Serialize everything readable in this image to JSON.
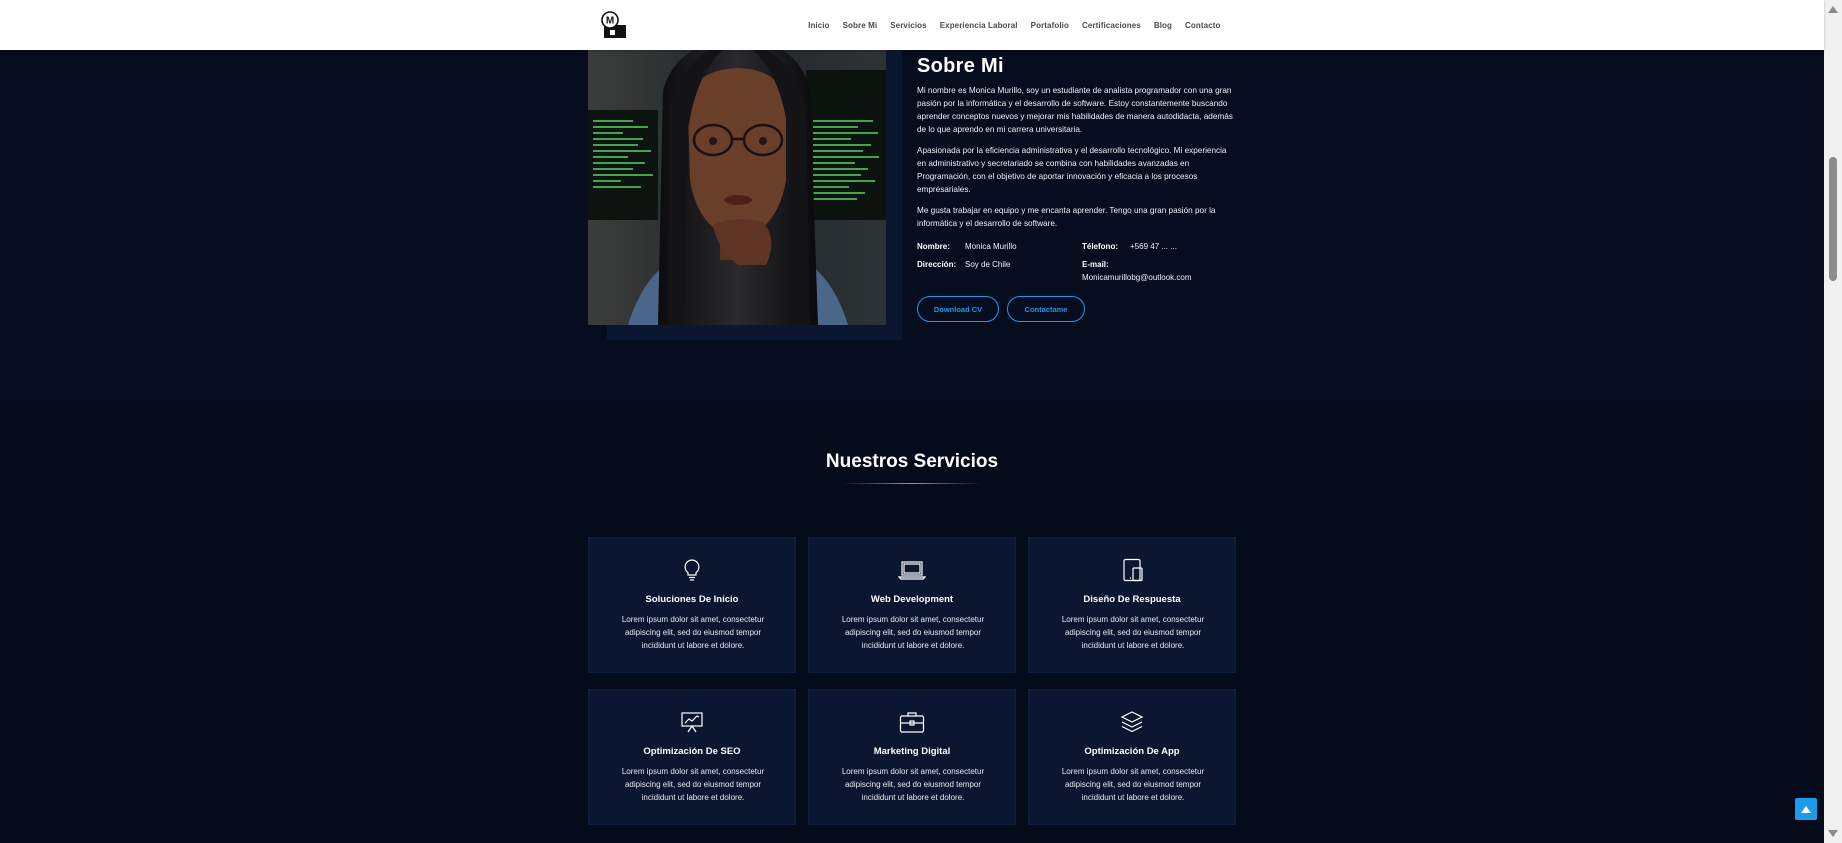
{
  "nav": {
    "logo_icon": "monogram-logo-icon",
    "links": [
      "Inicio",
      "Sobre Mi",
      "Servicios",
      "Experiencia Laboral",
      "Portafolio",
      "Certificaciones",
      "Blog",
      "Contacto"
    ]
  },
  "about": {
    "title": "Sobre Mi",
    "paragraphs": [
      "Mi nombre es Monica Murillo, soy un estudiante de analista programador con una gran pasión por la informática y el desarrollo de software. Estoy constantemente buscando aprender conceptos nuevos y mejorar mis habilidades de manera autodidacta, además de lo que aprendo en mi carrera universitaria.",
      "Apasionada por la eficiencia administrativa y el desarrollo tecnológico. Mi experiencia en administrativo y secretariado se combina con habilidades avanzadas en Programación, con el objetivo de aportar innovación y eficacia a los procesos empresariales.",
      "Me gusta trabajar en equipo y me encanta aprender. Tengo una gran pasión por la informática y el desarrollo de software."
    ],
    "info": {
      "nombre_label": "Nombre:",
      "nombre_value": "Monica Murillo",
      "direccion_label": "Dirección:",
      "direccion_value": "Soy de Chile",
      "telefono_label": "Télefono:",
      "telefono_value": "+569 47 ... ...",
      "email_label": "E-mail:",
      "email_value": "Monicamurillobg@outlook.com"
    },
    "buttons": {
      "download": "Download CV",
      "contact": "Contactame"
    }
  },
  "services": {
    "title": "Nuestros Servicios",
    "items": [
      {
        "icon": "lightbulb-icon",
        "title": "Soluciones De Inicio",
        "desc": "Lorem ipsum dolor sit amet, consectetur adipiscing elit, sed do eiusmod tempor incididunt ut labore et dolore."
      },
      {
        "icon": "laptop-icon",
        "title": "Web Development",
        "desc": "Lorem ipsum dolor sit amet, consectetur adipiscing elit, sed do eiusmod tempor incididunt ut labore et dolore."
      },
      {
        "icon": "devices-icon",
        "title": "Diseño De Respuesta",
        "desc": "Lorem ipsum dolor sit amet, consectetur adipiscing elit, sed do eiusmod tempor incididunt ut labore et dolore."
      },
      {
        "icon": "presentation-chart-icon",
        "title": "Optimización De SEO",
        "desc": "Lorem ipsum dolor sit amet, consectetur adipiscing elit, sed do eiusmod tempor incididunt ut labore et dolore."
      },
      {
        "icon": "briefcase-icon",
        "title": "Marketing Digital",
        "desc": "Lorem ipsum dolor sit amet, consectetur adipiscing elit, sed do eiusmod tempor incididunt ut labore et dolore."
      },
      {
        "icon": "layers-icon",
        "title": "Optimización De App",
        "desc": "Lorem ipsum dolor sit amet, consectetur adipiscing elit, sed do eiusmod tempor incididunt ut labore et dolore."
      }
    ]
  },
  "colors": {
    "background": "#050d1f",
    "card": "#0b1731",
    "accent": "#1c9be8",
    "nav_bg": "#ffffff"
  }
}
